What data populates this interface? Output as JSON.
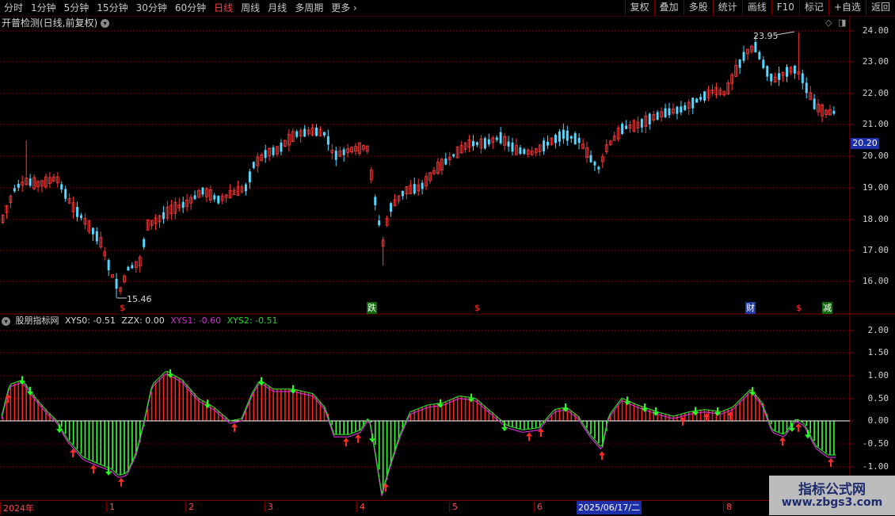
{
  "toolbar": {
    "periods": [
      "分时",
      "1分钟",
      "5分钟",
      "15分钟",
      "30分钟",
      "60分钟",
      "日线",
      "周线",
      "月线",
      "多周期",
      "更多"
    ],
    "active_period": "日线",
    "more_arrow": "›",
    "buttons": [
      "复权",
      "叠加",
      "多股",
      "统计",
      "画线",
      "F10",
      "标记",
      "+自选",
      "返回"
    ]
  },
  "main_chart": {
    "title": "开普检测(日线,前复权)",
    "high_label": "23.95",
    "low_label": "15.46",
    "current_price_tag": "20.20",
    "y_ticks": [
      "24.00",
      "23.00",
      "22.00",
      "21.00",
      "20.00",
      "19.00",
      "18.00",
      "17.00",
      "16.00"
    ],
    "signals": [
      {
        "text": "$",
        "color": "#ff3030",
        "bg": "#000"
      },
      {
        "text": "跌",
        "color": "#ffffff",
        "bg": "#0d6b0d"
      },
      {
        "text": "$",
        "color": "#ff3030",
        "bg": "#000"
      },
      {
        "text": "财",
        "color": "#ffffff",
        "bg": "#1c3aa8"
      },
      {
        "text": "$",
        "color": "#ff3030",
        "bg": "#000"
      },
      {
        "text": "减",
        "color": "#ffffff",
        "bg": "#0d6b0d"
      }
    ]
  },
  "indicator": {
    "name": "股朋指标网",
    "xys0": "XYS0: -0.51",
    "zzx": "ZZX: 0.00",
    "xys1": "XYS1: -0.60",
    "xys2": "XYS2: -0.51",
    "y_ticks": [
      "2.00",
      "1.50",
      "1.00",
      "0.50",
      "0.00",
      "-0.50",
      "-1.00"
    ]
  },
  "date_axis": {
    "labels": [
      "2024年",
      "1",
      "2",
      "3",
      "4",
      "5",
      "6",
      "8"
    ],
    "highlight": "2025/06/17/二"
  },
  "watermark": {
    "line1": "指标公式网",
    "line2": "www.zbgs3.com"
  },
  "colors": {
    "up": "#ff3a3a",
    "down": "#54d8ff",
    "hist_up": "#ff2020",
    "hist_down": "#39ff39",
    "xys1": "#cc33cc",
    "xys2": "#2ad42a",
    "grid": "#8a0000"
  }
}
